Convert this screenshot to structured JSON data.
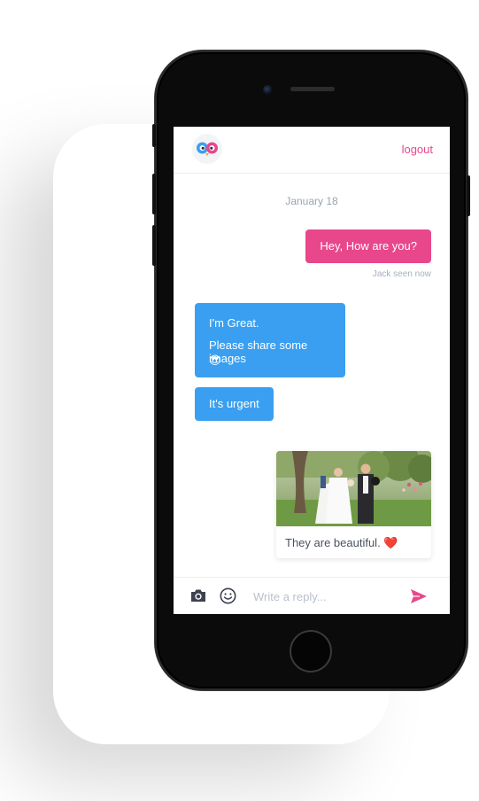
{
  "header": {
    "logout_label": "logout",
    "logo_icon": "owl-logo-icon"
  },
  "chat": {
    "date_divider": "January 18",
    "messages": [
      {
        "side": "right",
        "type": "text",
        "text": "Hey, How are you?"
      },
      {
        "side": "left",
        "type": "text",
        "lines": [
          "I'm Great.",
          "Please share some images",
          "😎"
        ]
      },
      {
        "side": "left",
        "type": "text",
        "text": "It's urgent"
      },
      {
        "side": "right",
        "type": "image",
        "caption": "They are beautiful. ❤️"
      }
    ],
    "seen_status": "Jack seen now"
  },
  "composer": {
    "placeholder": "Write a reply...",
    "value": "",
    "icons": [
      "camera-icon",
      "emoji-icon",
      "send-icon"
    ]
  },
  "colors": {
    "accent_pink": "#e8478b",
    "accent_blue": "#3a9ff0",
    "muted_text": "#9aa3b0"
  }
}
